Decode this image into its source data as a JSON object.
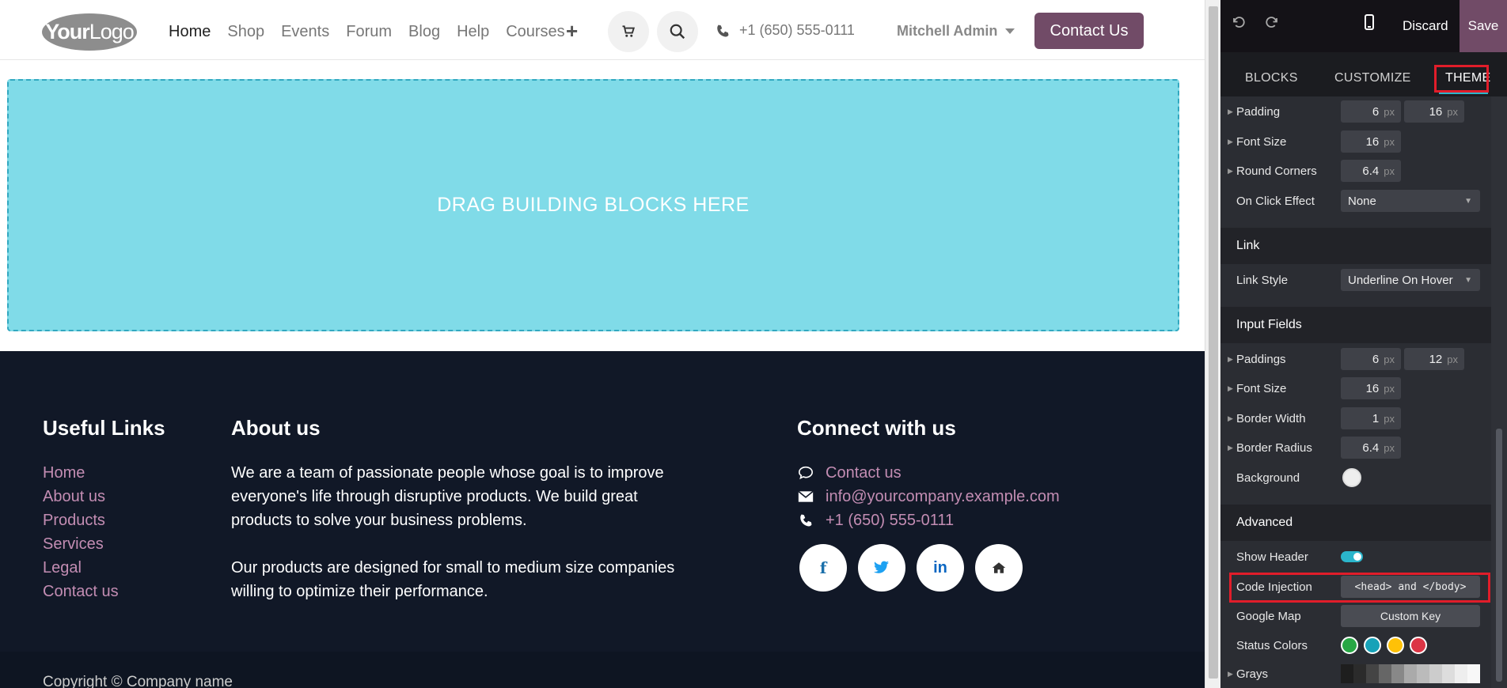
{
  "header": {
    "logo_your": "Your",
    "logo_logo": "Logo",
    "nav": [
      "Home",
      "Shop",
      "Events",
      "Forum",
      "Blog",
      "Help",
      "Courses"
    ],
    "plus": "+",
    "phone": "+1 (650) 555-0111",
    "user": "Mitchell Admin",
    "contact_button": "Contact Us"
  },
  "drop_zone": {
    "text": "DRAG BUILDING BLOCKS HERE"
  },
  "footer": {
    "useful_links_title": "Useful Links",
    "links": [
      "Home",
      "About us",
      "Products",
      "Services",
      "Legal",
      "Contact us"
    ],
    "about_title": "About us",
    "about_p1": "We are a team of passionate people whose goal is to improve everyone's life through disruptive products. We build great products to solve your business problems.",
    "about_p2": "Our products are designed for small to medium size companies willing to optimize their performance.",
    "connect_title": "Connect with us",
    "contact_link": "Contact us",
    "email": "info@yourcompany.example.com",
    "phone": "+1 (650) 555-0111",
    "social_facebook": "f",
    "social_linkedin": "in",
    "copyright": "Copyright © Company name"
  },
  "panel": {
    "discard": "Discard",
    "save": "Save",
    "tabs": [
      "BLOCKS",
      "CUSTOMIZE",
      "THEME"
    ],
    "unit": "px",
    "padding_label": "Padding",
    "padding_values": [
      "6",
      "16"
    ],
    "font_size_label": "Font Size",
    "font_size_value": "16",
    "round_corners_label": "Round Corners",
    "round_corners_value": "6.4",
    "on_click_label": "On Click Effect",
    "on_click_value": "None",
    "link_section": "Link",
    "link_style_label": "Link Style",
    "link_style_value": "Underline On Hover",
    "input_section": "Input Fields",
    "paddings_label": "Paddings",
    "paddings_values": [
      "6",
      "12"
    ],
    "input_font_size_label": "Font Size",
    "input_font_size_value": "16",
    "border_width_label": "Border Width",
    "border_width_value": "1",
    "border_radius_label": "Border Radius",
    "border_radius_value": "6.4",
    "background_label": "Background",
    "advanced_section": "Advanced",
    "show_header_label": "Show Header",
    "code_injection_label": "Code Injection",
    "code_injection_value": "<head> and </body>",
    "google_map_label": "Google Map",
    "google_map_value": "Custom Key",
    "status_colors_label": "Status Colors",
    "status_colors": [
      "#28a745",
      "#17a2b8",
      "#ffc107",
      "#dc3545"
    ],
    "grays_label": "Grays",
    "grays": [
      "#1e1e1e",
      "#2b2b2b",
      "#444",
      "#666",
      "#888",
      "#aaa",
      "#bbb",
      "#ccc",
      "#ddd",
      "#eee",
      "#f8f8f8"
    ]
  }
}
